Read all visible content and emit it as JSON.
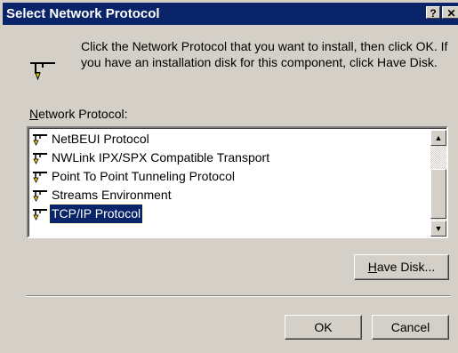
{
  "window": {
    "title": "Select Network Protocol",
    "help_glyph": "?",
    "close_glyph": "✕"
  },
  "intro": {
    "text": "Click the Network Protocol that you want to install, then click OK.  If you have an installation disk for this component, click Have Disk."
  },
  "list": {
    "label_accel": "N",
    "label_rest": "etwork Protocol:",
    "items": [
      {
        "label": "NetBEUI Protocol",
        "selected": false
      },
      {
        "label": "NWLink IPX/SPX Compatible Transport",
        "selected": false
      },
      {
        "label": "Point To Point Tunneling Protocol",
        "selected": false
      },
      {
        "label": "Streams Environment",
        "selected": false
      },
      {
        "label": "TCP/IP Protocol",
        "selected": true
      }
    ]
  },
  "buttons": {
    "have_disk_accel": "H",
    "have_disk_rest": "ave Disk...",
    "ok": "OK",
    "cancel": "Cancel"
  },
  "colors": {
    "titlebar": "#0a246a",
    "face": "#d4d0c8",
    "selection": "#0a246a"
  }
}
